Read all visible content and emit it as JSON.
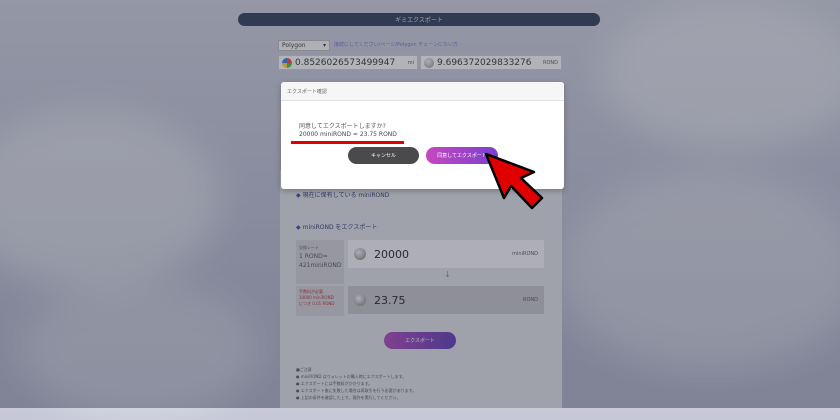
{
  "header": {
    "title": "ギミエクスポート"
  },
  "chain": {
    "selected": "Polygon",
    "notice": "接続にしてください/ページ/Polygon チェーンにない方"
  },
  "balances": {
    "left": {
      "value": "0.8526026573499947",
      "unit": "mi"
    },
    "right": {
      "value": "9.696372029833276",
      "unit": "ROND"
    }
  },
  "export_section": {
    "held_label": "現在に保有している miniROND",
    "export_label": "miniROND をエクスポート",
    "rate_label": "交換レート",
    "rate_value": "1 ROND=\n421miniROND",
    "fee_note": "手数料が必要\n10000 miniROND\nにつき 0.01 ROND",
    "input_amount": "20000",
    "input_unit": "miniROND",
    "output_amount": "23.75",
    "output_unit": "ROND",
    "arrow": "↓",
    "export_button": "エクスポート"
  },
  "notes": {
    "title": "■ご注意",
    "items": [
      "miniROND はウォレットの購入時にエクスポートします。",
      "エクスポートには手数料がかかります。",
      "エクスポート後に失敗した場合は再取引を行う必要があります。",
      "上記の条件を確認した上で、操作を実行してください。"
    ]
  },
  "modal": {
    "title": "エクスポート確認",
    "question": "同意してエクスポートしますか?",
    "summary": "20000 miniROND = 23.75 ROND",
    "cancel_label": "キャンセル",
    "agree_label": "同意してエクスポート"
  },
  "colors": {
    "highlight_underline": "#e00000",
    "pointer": "#e00000",
    "accent": "#a845b5"
  }
}
